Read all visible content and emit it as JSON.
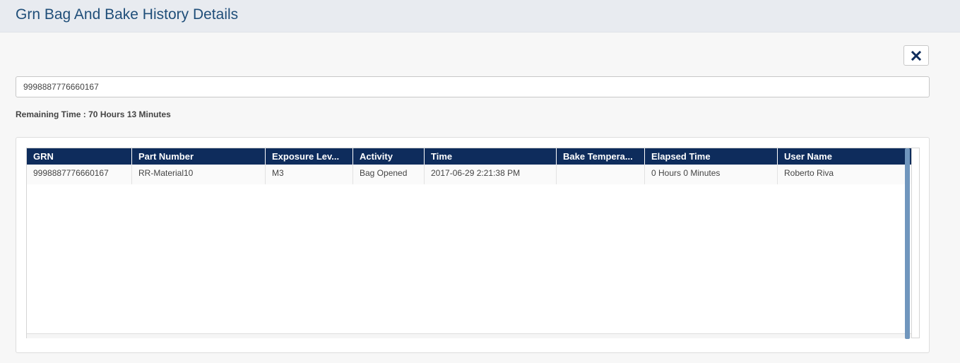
{
  "header": {
    "title": "Grn Bag And Bake History Details"
  },
  "close_button": {
    "icon": "close-icon"
  },
  "search": {
    "value": "9998887776660167"
  },
  "remaining_time": "Remaining Time : 70 Hours 13 Minutes",
  "table": {
    "columns": [
      "GRN",
      "Part Number",
      "Exposure Lev...",
      "Activity",
      "Time",
      "Bake Tempera...",
      "Elapsed Time",
      "User Name"
    ],
    "rows": [
      {
        "grn": "9998887776660167",
        "part_number": "RR-Material10",
        "exposure_level": "M3",
        "activity": "Bag Opened",
        "time": "2017-06-29 2:21:38 PM",
        "bake_temperature": "",
        "elapsed_time": "0 Hours 0 Minutes",
        "user_name": "Roberto Riva"
      }
    ]
  },
  "colors": {
    "header_bg": "#e8ebf0",
    "title": "#1f4e79",
    "table_header_bg": "#0e2c5c",
    "scrollbar": "#7096bd"
  }
}
